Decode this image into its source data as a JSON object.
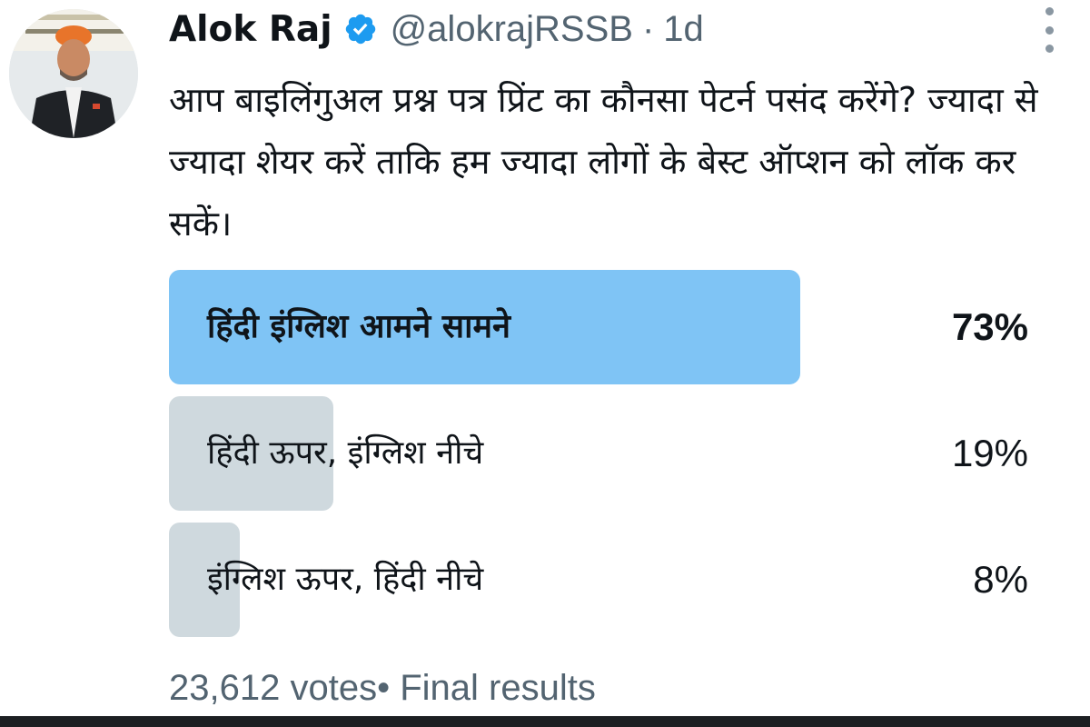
{
  "tweet": {
    "author_name": "Alok Raj",
    "handle": "@alokrajRSSB",
    "separator": "·",
    "time": "1d",
    "text": "आप बाइलिंगुअल प्रश्न पत्र प्रिंट का कौनसा पेटर्न पसंद करेंगे? ज्यादा से ज्यादा शेयर करें ताकि हम ज्यादा लोगों के बेस्ट ऑप्शन को लॉक कर सकें।"
  },
  "poll": {
    "options": [
      {
        "label": "हिंदी इंग्लिश आमने सामने",
        "percent_text": "73%",
        "percent": 73,
        "winner": true
      },
      {
        "label": "हिंदी ऊपर, इंग्लिश नीचे",
        "percent_text": "19%",
        "percent": 19,
        "winner": false
      },
      {
        "label": "इंग्लिश ऊपर, हिंदी नीचे",
        "percent_text": "8%",
        "percent": 8,
        "winner": false
      }
    ],
    "votes": "23,612 votes",
    "meta_separator": "•",
    "status": "Final results"
  },
  "colors": {
    "winner_bar": "#7fc4f5",
    "other_bar": "#cfd9de",
    "text": "#0f1419",
    "secondary_text": "#536471",
    "verified": "#1d9bf0"
  },
  "icons": {
    "verified": "verified-badge-icon",
    "more": "more-options-icon"
  }
}
